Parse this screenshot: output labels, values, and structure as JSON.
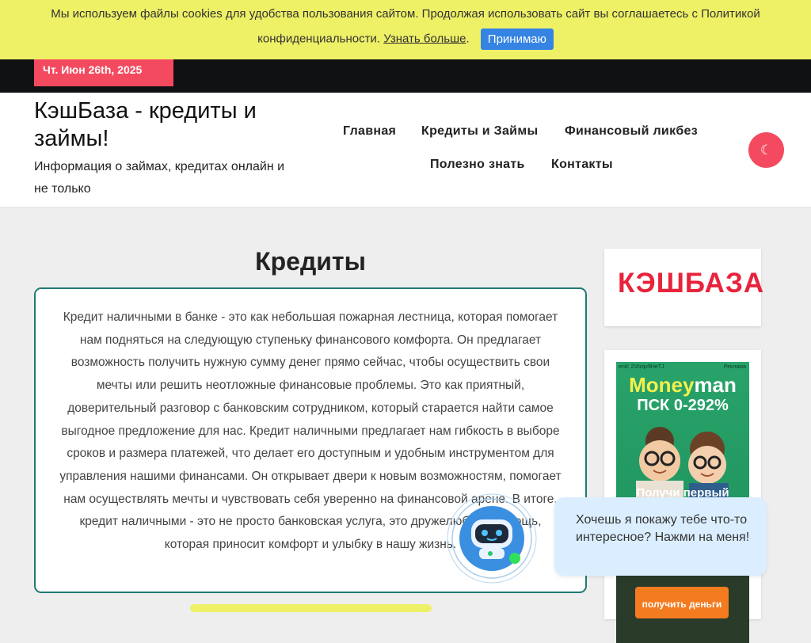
{
  "cookie": {
    "text_line1": "Мы используем файлы cookies для удобства пользования сайтом. Продолжая использовать сайт вы соглашаетесь с Политикой",
    "text_line2": "конфиденциальности.",
    "learn_more": "Узнать больше",
    "period": ".",
    "accept": "Принимаю"
  },
  "topbar": {
    "date": "Чт. Июн 26th, 2025"
  },
  "header": {
    "title": "КэшБаза - кредиты и займы!",
    "description": "Информация о займах, кредитах онлайн и не только"
  },
  "nav": {
    "items": [
      {
        "label": "Главная"
      },
      {
        "label": "Кредиты и Займы"
      },
      {
        "label": "Финансовый ликбез"
      },
      {
        "label": "Полезно знать"
      },
      {
        "label": "Контакты"
      }
    ],
    "theme_icon": "☾"
  },
  "main": {
    "title": "Кредиты",
    "body": "Кредит наличными в банке - это как небольшая пожарная лестница, которая помогает нам подняться на следующую ступеньку финансового комфорта. Он предлагает возможность получить нужную сумму денег прямо сейчас, чтобы осуществить свои мечты или решить неотложные финансовые проблемы. Это как приятный, доверительный разговор с банковским сотрудником, который старается найти самое выгодное предложение для нас. Кредит наличными предлагает нам гибкость в выборе сроков и размера платежей, что делает его доступным и удобным инструментом для управления нашими финансами. Он открывает двери к новым возможностям, помогает нам осуществлять мечты и чувствовать себя уверенно на финансовой арене. В итоге, кредит наличными - это не просто банковская услуга, это дружелюбная помощь, которая приносит комфорт и улыбку в нашу жизнь."
  },
  "sidebar": {
    "logo": "КЭШБАЗА",
    "ad": {
      "erid": "erid: 2Vtzqv9HeTJ",
      "label": "Реклама",
      "brand_a": "Money",
      "brand_b": "man",
      "psk": "ПСК 0-292%",
      "cta": "Получи первый",
      "button": "получить деньги"
    }
  },
  "chat": {
    "message": "Хочешь я покажу тебе что-то интересное? Нажми на меня!"
  },
  "colors": {
    "accent": "#f44a5f",
    "cookie_bg": "#eef066",
    "cookie_button": "#3584e4",
    "content_border": "#1f7a73",
    "logo_red": "#e8233c"
  }
}
